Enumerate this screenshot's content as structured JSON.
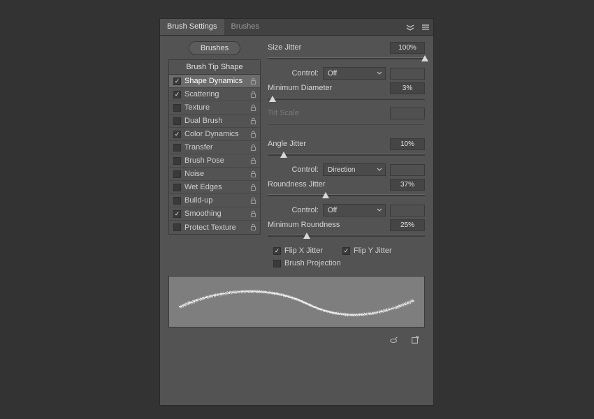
{
  "tabs": {
    "active": "Brush Settings",
    "inactive": "Brushes"
  },
  "brushes_button": "Brushes",
  "list_header": "Brush Tip Shape",
  "options": [
    {
      "label": "Shape Dynamics",
      "checked": true,
      "selected": true
    },
    {
      "label": "Scattering",
      "checked": true,
      "selected": false
    },
    {
      "label": "Texture",
      "checked": false,
      "selected": false
    },
    {
      "label": "Dual Brush",
      "checked": false,
      "selected": false
    },
    {
      "label": "Color Dynamics",
      "checked": true,
      "selected": false
    },
    {
      "label": "Transfer",
      "checked": false,
      "selected": false
    },
    {
      "label": "Brush Pose",
      "checked": false,
      "selected": false
    },
    {
      "label": "Noise",
      "checked": false,
      "selected": false
    },
    {
      "label": "Wet Edges",
      "checked": false,
      "selected": false
    },
    {
      "label": "Build-up",
      "checked": false,
      "selected": false
    },
    {
      "label": "Smoothing",
      "checked": true,
      "selected": false
    },
    {
      "label": "Protect Texture",
      "checked": false,
      "selected": false
    }
  ],
  "sliders": {
    "size_jitter": {
      "label": "Size Jitter",
      "value": "100%",
      "pos": 100
    },
    "min_diameter": {
      "label": "Minimum Diameter",
      "value": "3%",
      "pos": 3
    },
    "tilt_scale": {
      "label": "Tilt Scale",
      "value": "",
      "pos": 0,
      "disabled": true
    },
    "angle_jitter": {
      "label": "Angle Jitter",
      "value": "10%",
      "pos": 10
    },
    "roundness_jitter": {
      "label": "Roundness Jitter",
      "value": "37%",
      "pos": 37
    },
    "min_roundness": {
      "label": "Minimum Roundness",
      "value": "25%",
      "pos": 25
    }
  },
  "controls": {
    "label": "Control:",
    "size": "Off",
    "angle": "Direction",
    "roundness": "Off"
  },
  "flip": {
    "x": {
      "label": "Flip X Jitter",
      "checked": true
    },
    "y": {
      "label": "Flip Y Jitter",
      "checked": true
    },
    "proj": {
      "label": "Brush Projection",
      "checked": false
    }
  }
}
